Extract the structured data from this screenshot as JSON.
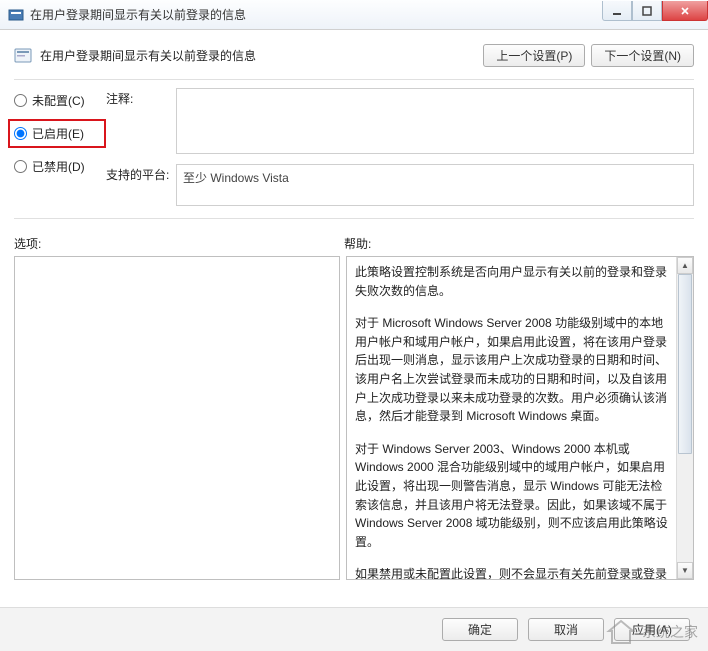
{
  "window": {
    "title": "在用户登录期间显示有关以前登录的信息"
  },
  "header": {
    "text": "在用户登录期间显示有关以前登录的信息",
    "prev_btn": "上一个设置(P)",
    "next_btn": "下一个设置(N)"
  },
  "state_radios": {
    "not_configured": "未配置(C)",
    "enabled": "已启用(E)",
    "disabled": "已禁用(D)",
    "selected": "enabled"
  },
  "fields": {
    "comment_label": "注释:",
    "comment_value": "",
    "platform_label": "支持的平台:",
    "platform_value": "至少 Windows Vista"
  },
  "section_labels": {
    "options": "选项:",
    "help": "帮助:"
  },
  "help_paragraphs": [
    "此策略设置控制系统是否向用户显示有关以前的登录和登录失败次数的信息。",
    "对于 Microsoft Windows Server 2008 功能级别域中的本地用户帐户和域用户帐户，如果启用此设置，将在该用户登录后出现一则消息，显示该用户上次成功登录的日期和时间、该用户名上次尝试登录而未成功的日期和时间，以及自该用户上次成功登录以来未成功登录的次数。用户必须确认该消息，然后才能登录到 Microsoft Windows 桌面。",
    "对于 Windows Server 2003、Windows 2000 本机或 Windows 2000 混合功能级别域中的域用户帐户，如果启用此设置，将出现一则警告消息，显示 Windows 可能无法检索该信息，并且该用户将无法登录。因此，如果该域不属于 Windows Server 2008 域功能级别，则不应该启用此策略设置。",
    "如果禁用或未配置此设置，则不会显示有关先前登录或登录失败的消息。"
  ],
  "footer": {
    "ok": "确定",
    "cancel": "取消",
    "apply": "应用(A)"
  },
  "watermark": {
    "text": "系统之家"
  }
}
